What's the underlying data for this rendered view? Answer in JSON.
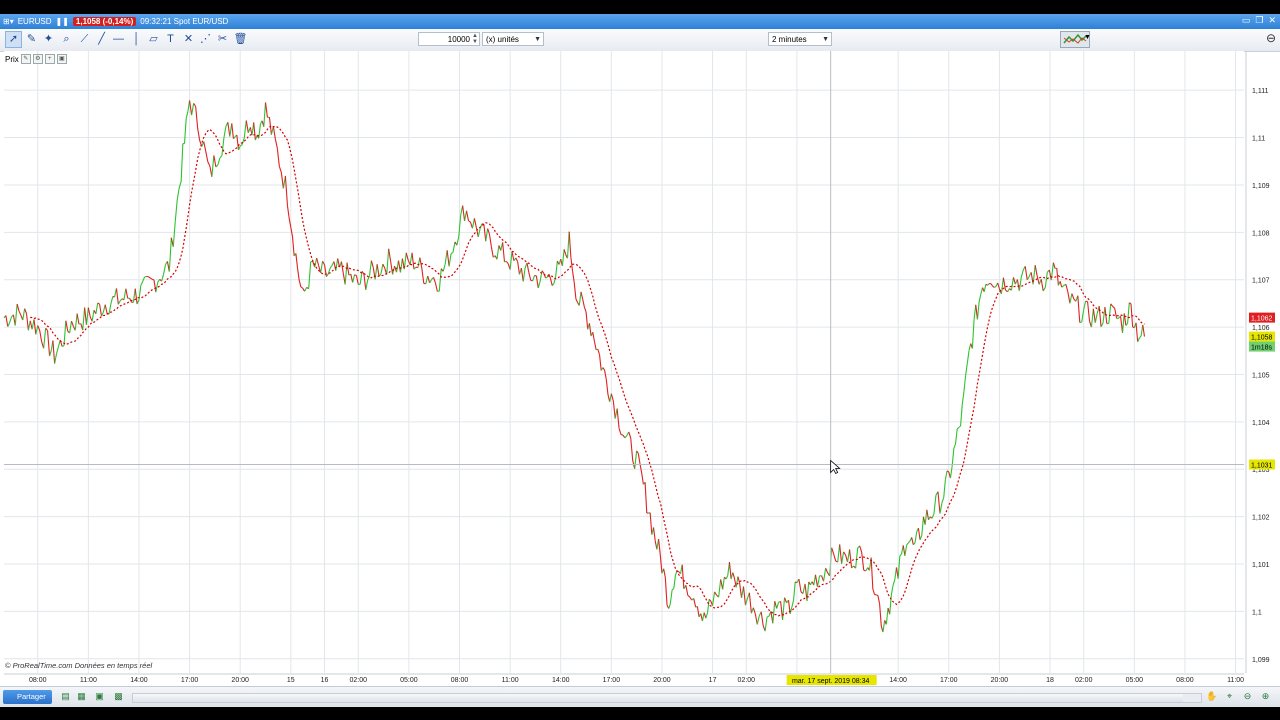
{
  "titlebar": {
    "instrument": "EURUSD",
    "price_badge": "1,1058 (-0,14%)",
    "time_label": "09:32:21 Spot EUR/USD"
  },
  "toolbar": {
    "quantity": "10000",
    "units_label": "(x) unités",
    "timeframe": "2 minutes"
  },
  "panel": {
    "label": "Prix"
  },
  "footer": {
    "copyright": "© ProRealTime.com  Données en temps réel",
    "share_label": "Partager"
  },
  "colors": {
    "up": "#2ec22e",
    "down": "#e02020",
    "sma": "#d40000",
    "grid": "#e2e6ea",
    "cursor_label_bg": "#e6e600",
    "price_label_red": "#e02020",
    "price_label_yellow": "#e6e600"
  },
  "chart_data": {
    "type": "line",
    "y_axis": {
      "ticks": [
        {
          "value": 1.111,
          "label": "1,111"
        },
        {
          "value": 1.11,
          "label": "1,11"
        },
        {
          "value": 1.109,
          "label": "1,109"
        },
        {
          "value": 1.108,
          "label": "1,108"
        },
        {
          "value": 1.107,
          "label": "1,107"
        },
        {
          "value": 1.106,
          "label": "1,106"
        },
        {
          "value": 1.105,
          "label": "1,105"
        },
        {
          "value": 1.104,
          "label": "1,104"
        },
        {
          "value": 1.103,
          "label": "1,103"
        },
        {
          "value": 1.102,
          "label": "1,102"
        },
        {
          "value": 1.101,
          "label": "1,101"
        },
        {
          "value": 1.1,
          "label": "1,1"
        },
        {
          "value": 1.099,
          "label": "1,099"
        }
      ],
      "range": [
        1.0987,
        1.1117
      ]
    },
    "x_axis": {
      "ticks": [
        {
          "t": 8,
          "label": "08:00"
        },
        {
          "t": 11,
          "label": "11:00"
        },
        {
          "t": 14,
          "label": "14:00"
        },
        {
          "t": 17,
          "label": "17:00"
        },
        {
          "t": 20,
          "label": "20:00"
        },
        {
          "t": 23,
          "label": "15"
        },
        {
          "t": 25,
          "label": "16"
        },
        {
          "t": 27,
          "label": "02:00"
        },
        {
          "t": 30,
          "label": "05:00"
        },
        {
          "t": 33,
          "label": "08:00"
        },
        {
          "t": 36,
          "label": "11:00"
        },
        {
          "t": 39,
          "label": "14:00"
        },
        {
          "t": 42,
          "label": "17:00"
        },
        {
          "t": 45,
          "label": "20:00"
        },
        {
          "t": 48,
          "label": "17"
        },
        {
          "t": 50,
          "label": "02:00"
        },
        {
          "t": 53,
          "label": "05:00"
        },
        {
          "t": 59,
          "label": "14:00"
        },
        {
          "t": 62,
          "label": "17:00"
        },
        {
          "t": 65,
          "label": "20:00"
        },
        {
          "t": 68,
          "label": "18"
        },
        {
          "t": 70,
          "label": "02:00"
        },
        {
          "t": 73,
          "label": "05:00"
        },
        {
          "t": 76,
          "label": "08:00"
        },
        {
          "t": 79,
          "label": "11:00"
        }
      ],
      "range": [
        6,
        79.5
      ]
    },
    "price_series": [
      [
        6,
        1.1062
      ],
      [
        7,
        1.1063
      ],
      [
        8,
        1.106
      ],
      [
        8.7,
        1.1056
      ],
      [
        9,
        1.1054
      ],
      [
        10,
        1.1061
      ],
      [
        11,
        1.1062
      ],
      [
        12,
        1.1065
      ],
      [
        13,
        1.1066
      ],
      [
        14,
        1.1067
      ],
      [
        15,
        1.107
      ],
      [
        15.8,
        1.1073
      ],
      [
        16.5,
        1.1093
      ],
      [
        17,
        1.1108
      ],
      [
        17.6,
        1.1102
      ],
      [
        18.2,
        1.1092
      ],
      [
        18.8,
        1.1098
      ],
      [
        19.5,
        1.1103
      ],
      [
        20,
        1.1099
      ],
      [
        20.6,
        1.1104
      ],
      [
        21,
        1.1101
      ],
      [
        21.5,
        1.1106
      ],
      [
        22.2,
        1.1097
      ],
      [
        22.8,
        1.1088
      ],
      [
        23.3,
        1.1075
      ],
      [
        23.7,
        1.1066
      ],
      [
        24.3,
        1.1073
      ],
      [
        25,
        1.1071
      ],
      [
        26,
        1.1072
      ],
      [
        27,
        1.1069
      ],
      [
        28,
        1.1072
      ],
      [
        28.8,
        1.1074
      ],
      [
        29.5,
        1.1073
      ],
      [
        30.3,
        1.1074
      ],
      [
        31,
        1.1071
      ],
      [
        31.8,
        1.107
      ],
      [
        32.5,
        1.1076
      ],
      [
        33.3,
        1.1085
      ],
      [
        34,
        1.1081
      ],
      [
        35,
        1.1077
      ],
      [
        36,
        1.1074
      ],
      [
        37,
        1.1071
      ],
      [
        38,
        1.107
      ],
      [
        38.5,
        1.1071
      ],
      [
        39,
        1.1072
      ],
      [
        39.5,
        1.1078
      ],
      [
        40,
        1.1066
      ],
      [
        40.5,
        1.1063
      ],
      [
        41,
        1.1058
      ],
      [
        41.5,
        1.1051
      ],
      [
        42,
        1.1046
      ],
      [
        42.8,
        1.1037
      ],
      [
        43.5,
        1.1032
      ],
      [
        44,
        1.1025
      ],
      [
        44.5,
        1.1017
      ],
      [
        45,
        1.101
      ],
      [
        45.4,
        1.1002
      ],
      [
        45.8,
        1.1009
      ],
      [
        46.3,
        1.1007
      ],
      [
        47,
        1.1003
      ],
      [
        47.5,
        1.0998
      ],
      [
        48,
        1.1002
      ],
      [
        48.6,
        1.1006
      ],
      [
        49.1,
        1.1009
      ],
      [
        49.6,
        1.1005
      ],
      [
        50.3,
        1.1002
      ],
      [
        51,
        1.0998
      ],
      [
        51.8,
        1.1001
      ],
      [
        52.5,
        1.1
      ],
      [
        53,
        1.1005
      ],
      [
        53.6,
        1.1004
      ],
      [
        54.1,
        1.1007
      ],
      [
        54.7,
        1.1009
      ],
      [
        55.3,
        1.1012
      ],
      [
        56,
        1.1011
      ],
      [
        56.6,
        1.1012
      ],
      [
        57.2,
        1.1011
      ],
      [
        57.7,
        1.1005
      ],
      [
        58.1,
        1.0997
      ],
      [
        58.5,
        1.1002
      ],
      [
        59,
        1.1008
      ],
      [
        59.5,
        1.1016
      ],
      [
        60,
        1.1013
      ],
      [
        60.5,
        1.1019
      ],
      [
        61,
        1.1021
      ],
      [
        61.6,
        1.1024
      ],
      [
        62,
        1.1028
      ],
      [
        62.4,
        1.1035
      ],
      [
        62.8,
        1.1042
      ],
      [
        63.2,
        1.1054
      ],
      [
        63.6,
        1.1062
      ],
      [
        64,
        1.1069
      ],
      [
        64.5,
        1.1071
      ],
      [
        65,
        1.1069
      ],
      [
        65.6,
        1.107
      ],
      [
        66.3,
        1.107
      ],
      [
        67,
        1.1071
      ],
      [
        67.6,
        1.107
      ],
      [
        68.2,
        1.1072
      ],
      [
        68.7,
        1.1068
      ],
      [
        69.3,
        1.1065
      ],
      [
        70,
        1.1063
      ],
      [
        70.8,
        1.1062
      ],
      [
        71.6,
        1.1063
      ],
      [
        72.3,
        1.1061
      ],
      [
        72.8,
        1.1064
      ],
      [
        73.2,
        1.1059
      ],
      [
        73.6,
        1.1058
      ]
    ],
    "cursor": {
      "t": 55,
      "value": 1.1031,
      "time_label": "mar. 17 sept. 2019 08:34",
      "price_label": "1,1031"
    },
    "current_price": {
      "value": 1.1058,
      "label": "1,1058"
    },
    "secondary_price": {
      "value": 1.1062,
      "label": "1,1062"
    },
    "countdown_label": "1m18s",
    "grid": true,
    "legend": "none"
  }
}
